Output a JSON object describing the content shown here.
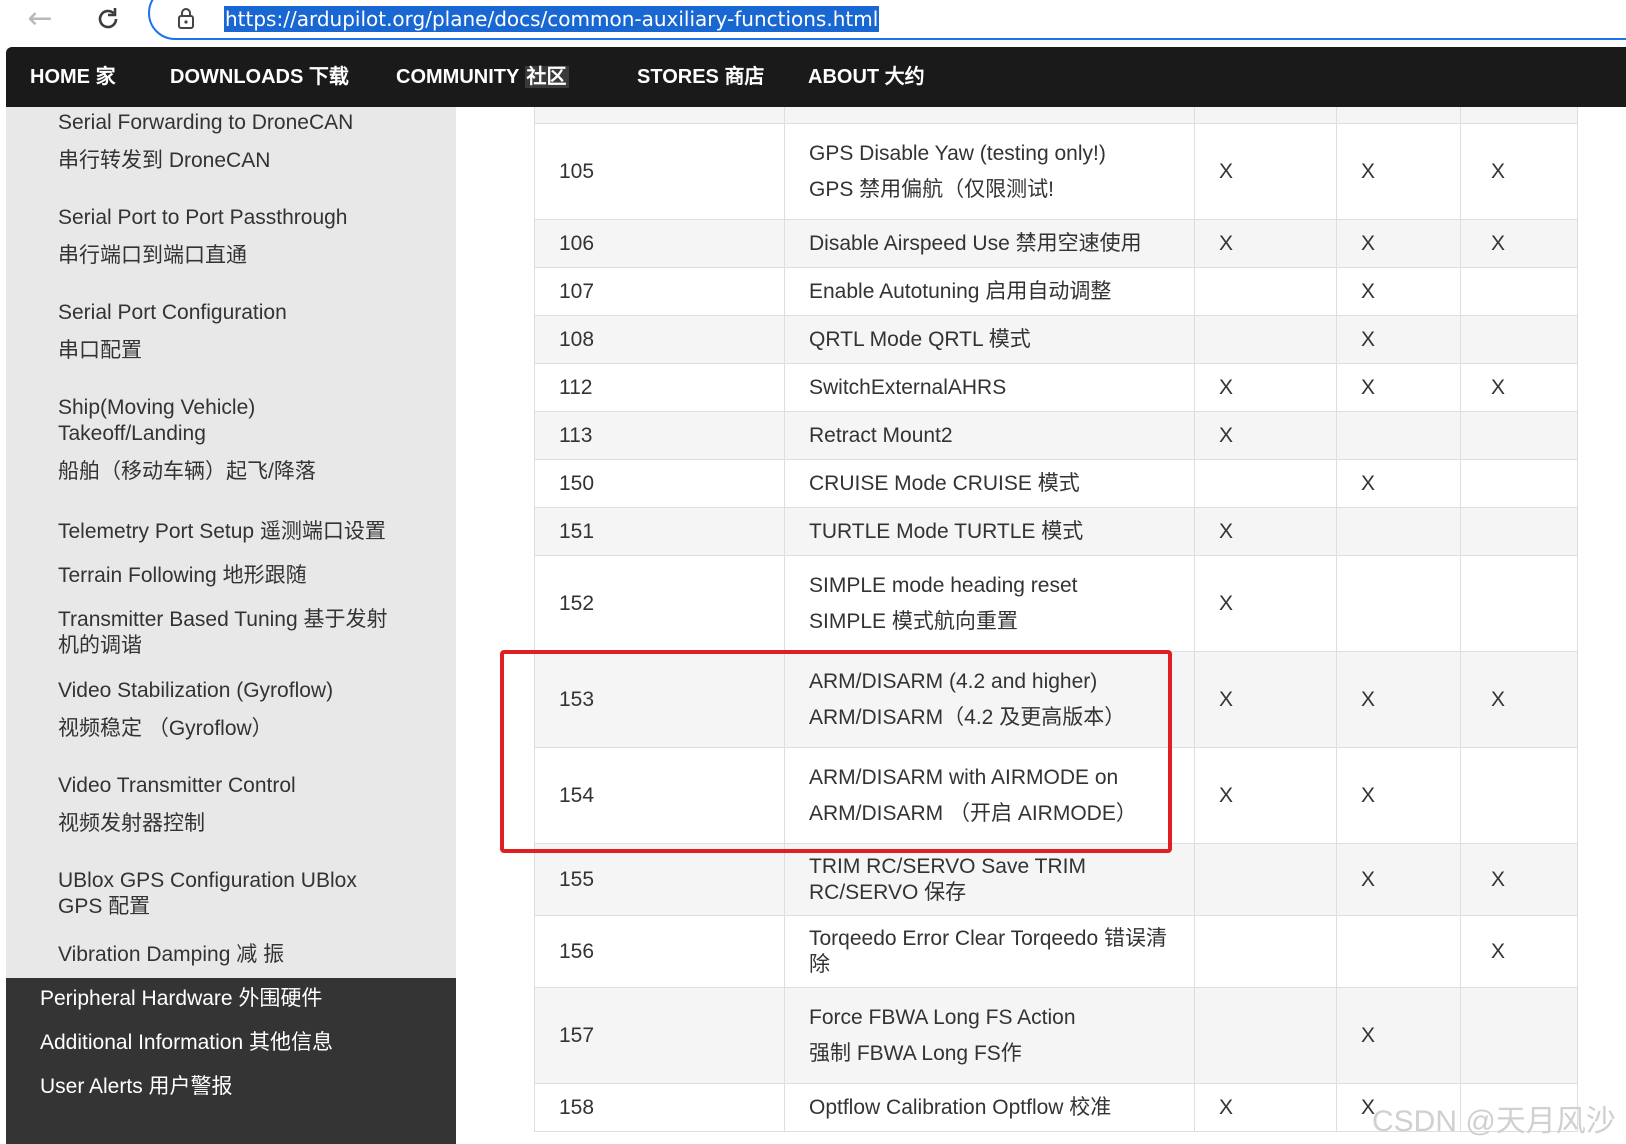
{
  "browser": {
    "url": "https://ardupilot.org/plane/docs/common-auxiliary-functions.html",
    "back_icon": "arrow-left-icon",
    "reload_icon": "reload-icon",
    "lock_icon": "lock-icon"
  },
  "top_nav": {
    "items": [
      {
        "en": "HOME",
        "zh": "家"
      },
      {
        "en": "DOWNLOADS",
        "zh": "下载"
      },
      {
        "en": "COMMUNITY",
        "zh": "社区"
      },
      {
        "en": "STORES",
        "zh": "商店"
      },
      {
        "en": "ABOUT",
        "zh": "大约"
      }
    ]
  },
  "sidebar": {
    "items": [
      {
        "en": "Serial Forwarding to DroneCAN",
        "zh": "串行转发到 DroneCAN"
      },
      {
        "en": "Serial Port to Port Passthrough",
        "zh": "串行端口到端口直通"
      },
      {
        "en": "Serial Port Configuration",
        "zh": "串口配置"
      },
      {
        "en": "Ship(Moving Vehicle) Takeoff/Landing",
        "zh": "船舶（移动车辆）起飞/降落"
      },
      {
        "en": "Telemetry Port Setup",
        "zh": "遥测端口设置"
      },
      {
        "en": "Terrain Following",
        "zh": "地形跟随"
      },
      {
        "en": "Transmitter Based Tuning",
        "zh": "基于发射机的调谐"
      },
      {
        "en": "Video Stabilization (Gyroflow)",
        "zh": "视频稳定 （Gyroflow）"
      },
      {
        "en": "Video Transmitter Control",
        "zh": "视频发射器控制"
      },
      {
        "en": "UBlox GPS Configuration",
        "zh": "UBlox GPS 配置"
      },
      {
        "en": "Vibration Damping",
        "zh": "减 振"
      }
    ],
    "sections": [
      {
        "en": "Peripheral Hardware",
        "zh": "外围硬件"
      },
      {
        "en": "Additional Information",
        "zh": "其他信息"
      },
      {
        "en": "User Alerts",
        "zh": "用户警报"
      }
    ]
  },
  "table": {
    "rows": [
      {
        "num": "105",
        "en": "GPS Disable Yaw (testing only!)",
        "zh": "GPS 禁用偏航（仅限测试!",
        "c1": "X",
        "c2": "X",
        "c3": "X"
      },
      {
        "num": "106",
        "en": "Disable Airspeed Use",
        "zh": "禁用空速使用",
        "c1": "X",
        "c2": "X",
        "c3": "X"
      },
      {
        "num": "107",
        "en": "Enable Autotuning",
        "zh": "启用自动调整",
        "c1": "",
        "c2": "X",
        "c3": ""
      },
      {
        "num": "108",
        "en": "QRTL Mode",
        "zh": "QRTL 模式",
        "c1": "",
        "c2": "X",
        "c3": ""
      },
      {
        "num": "112",
        "en": "SwitchExternalAHRS",
        "zh": "",
        "c1": "X",
        "c2": "X",
        "c3": "X"
      },
      {
        "num": "113",
        "en": "Retract Mount2",
        "zh": "",
        "c1": "X",
        "c2": "",
        "c3": ""
      },
      {
        "num": "150",
        "en": "CRUISE Mode",
        "zh": "CRUISE 模式",
        "c1": "",
        "c2": "X",
        "c3": ""
      },
      {
        "num": "151",
        "en": "TURTLE Mode",
        "zh": "TURTLE 模式",
        "c1": "X",
        "c2": "",
        "c3": ""
      },
      {
        "num": "152",
        "en": "SIMPLE mode heading reset",
        "zh": "SIMPLE 模式航向重置",
        "c1": "X",
        "c2": "",
        "c3": ""
      },
      {
        "num": "153",
        "en": "ARM/DISARM (4.2 and higher)",
        "zh": "ARM/DISARM（4.2 及更高版本）",
        "c1": "X",
        "c2": "X",
        "c3": "X"
      },
      {
        "num": "154",
        "en": "ARM/DISARM with AIRMODE on",
        "zh": "ARM/DISARM （开启 AIRMODE）",
        "c1": "X",
        "c2": "X",
        "c3": ""
      },
      {
        "num": "155",
        "en": "TRIM RC/SERVO Save",
        "zh": "TRIM RC/SERVO 保存",
        "c1": "",
        "c2": "X",
        "c3": "X"
      },
      {
        "num": "156",
        "en": "Torqeedo Error Clear",
        "zh": "Torqeedo 错误清除",
        "c1": "",
        "c2": "",
        "c3": "X"
      },
      {
        "num": "157",
        "en": "Force FBWA Long FS Action",
        "zh": "强制 FBWA Long FS作",
        "c1": "",
        "c2": "X",
        "c3": ""
      },
      {
        "num": "158",
        "en": "Optflow Calibration",
        "zh": "Optflow 校准",
        "c1": "X",
        "c2": "X",
        "c3": ""
      }
    ]
  },
  "watermark": "CSDN @天月风沙",
  "colors": {
    "highlight": "#e02020",
    "nav_bg": "#1a1a1a",
    "sidebar_bg": "#e8e8e8",
    "url_selection": "#1967d2"
  }
}
